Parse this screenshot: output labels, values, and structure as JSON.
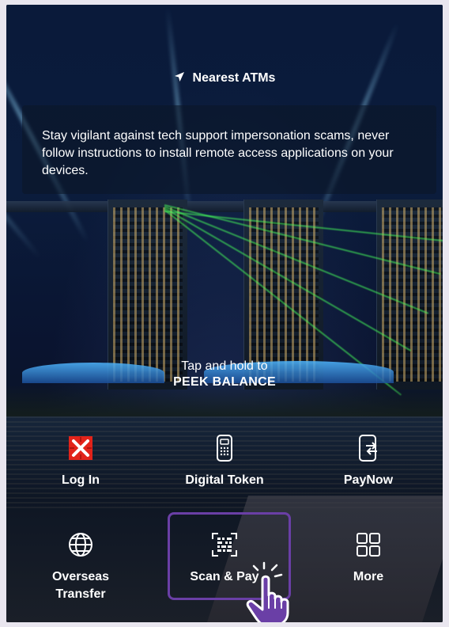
{
  "header": {
    "nearest_atms": "Nearest ATMs",
    "nav_icon": "navigation-arrow-icon"
  },
  "notice": {
    "text": "Stay vigilant against tech support impersonation scams, never follow instructions to install remote access applications on your devices."
  },
  "peek": {
    "line1": "Tap and hold to",
    "line2": "PEEK BALANCE"
  },
  "actions": [
    {
      "label": "Log In",
      "icon": "dbs-logo-icon"
    },
    {
      "label": "Digital Token",
      "icon": "token-device-icon"
    },
    {
      "label": "PayNow",
      "icon": "phone-transfer-icon"
    },
    {
      "label": "Overseas Transfer",
      "icon": "globe-icon"
    },
    {
      "label": "Scan & Pay",
      "icon": "qr-scan-icon"
    },
    {
      "label": "More",
      "icon": "grid-icon"
    }
  ],
  "colors": {
    "brand_red": "#e2231a",
    "highlight_purple": "#6a3fa6",
    "text": "#ffffff"
  }
}
